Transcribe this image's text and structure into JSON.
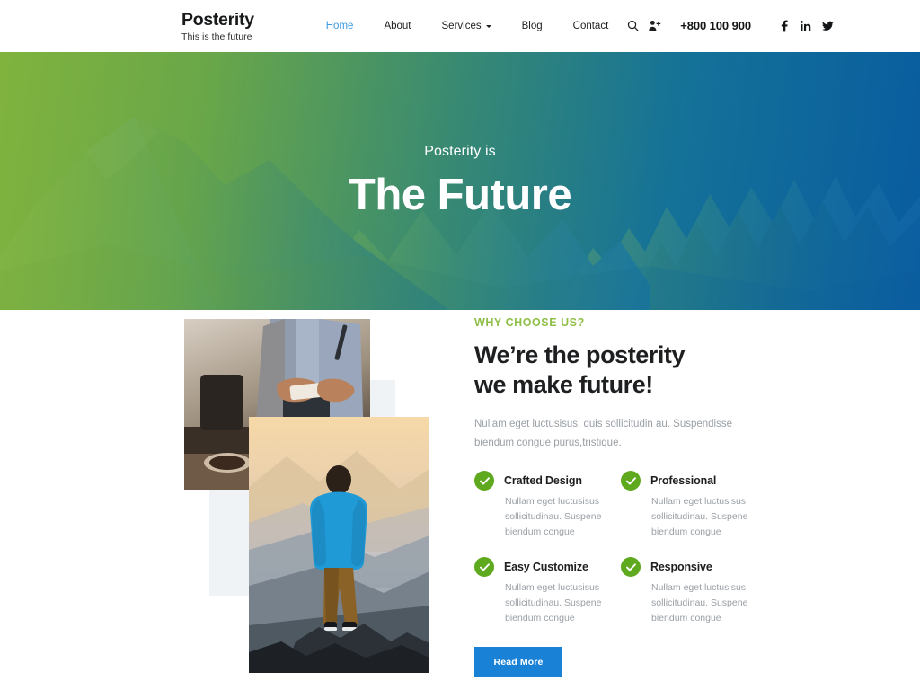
{
  "header": {
    "brand_name": "Posterity",
    "brand_tagline": "This is the future",
    "nav": [
      {
        "label": "Home",
        "active": true,
        "dropdown": false
      },
      {
        "label": "About",
        "active": false,
        "dropdown": false
      },
      {
        "label": "Services",
        "active": false,
        "dropdown": true
      },
      {
        "label": "Blog",
        "active": false,
        "dropdown": false
      },
      {
        "label": "Contact",
        "active": false,
        "dropdown": false
      }
    ],
    "search_icon": "search-icon",
    "account_icon": "user-plus-icon",
    "phone": "+800 100 900",
    "socials": [
      {
        "name": "facebook-icon",
        "glyph": "f"
      },
      {
        "name": "linkedin-icon",
        "glyph": "in"
      },
      {
        "name": "twitter-icon",
        "glyph": "twitter"
      }
    ],
    "active_link_color": "#3b9ae1"
  },
  "hero": {
    "kicker": "Posterity is",
    "title": "The Future",
    "gradient_from": "#7db03c",
    "gradient_to": "#085c9f",
    "background_image": "mountain-range-photo"
  },
  "main": {
    "collage": {
      "photo_top": "business-people-phone-photo",
      "photo_bottom": "man-standing-on-mountain-photo",
      "accent_square_color": "#f0f3f6"
    },
    "eyebrow": "WHY CHOOSE US?",
    "eyebrow_color": "#8fbf48",
    "headline_line1": "We’re the posterity",
    "headline_line2": "we make future!",
    "lede": "Nullam eget luctusisus, quis sollicitudin au. Suspendisse biendum congue purus,tristique.",
    "features": [
      {
        "title": "Crafted Design",
        "desc": "Nullam eget luctusisus sollicitudinau. Suspene biendum congue"
      },
      {
        "title": "Professional",
        "desc": "Nullam eget luctusisus sollicitudinau. Suspene biendum congue"
      },
      {
        "title": "Easy Customize",
        "desc": "Nullam eget luctusisus sollicitudinau. Suspene biendum congue"
      },
      {
        "title": "Responsive",
        "desc": "Nullam eget luctusisus sollicitudinau. Suspene biendum congue"
      }
    ],
    "check_color": "#5fa91f",
    "read_more_label": "Read More",
    "read_more_color": "#1a82d6"
  }
}
